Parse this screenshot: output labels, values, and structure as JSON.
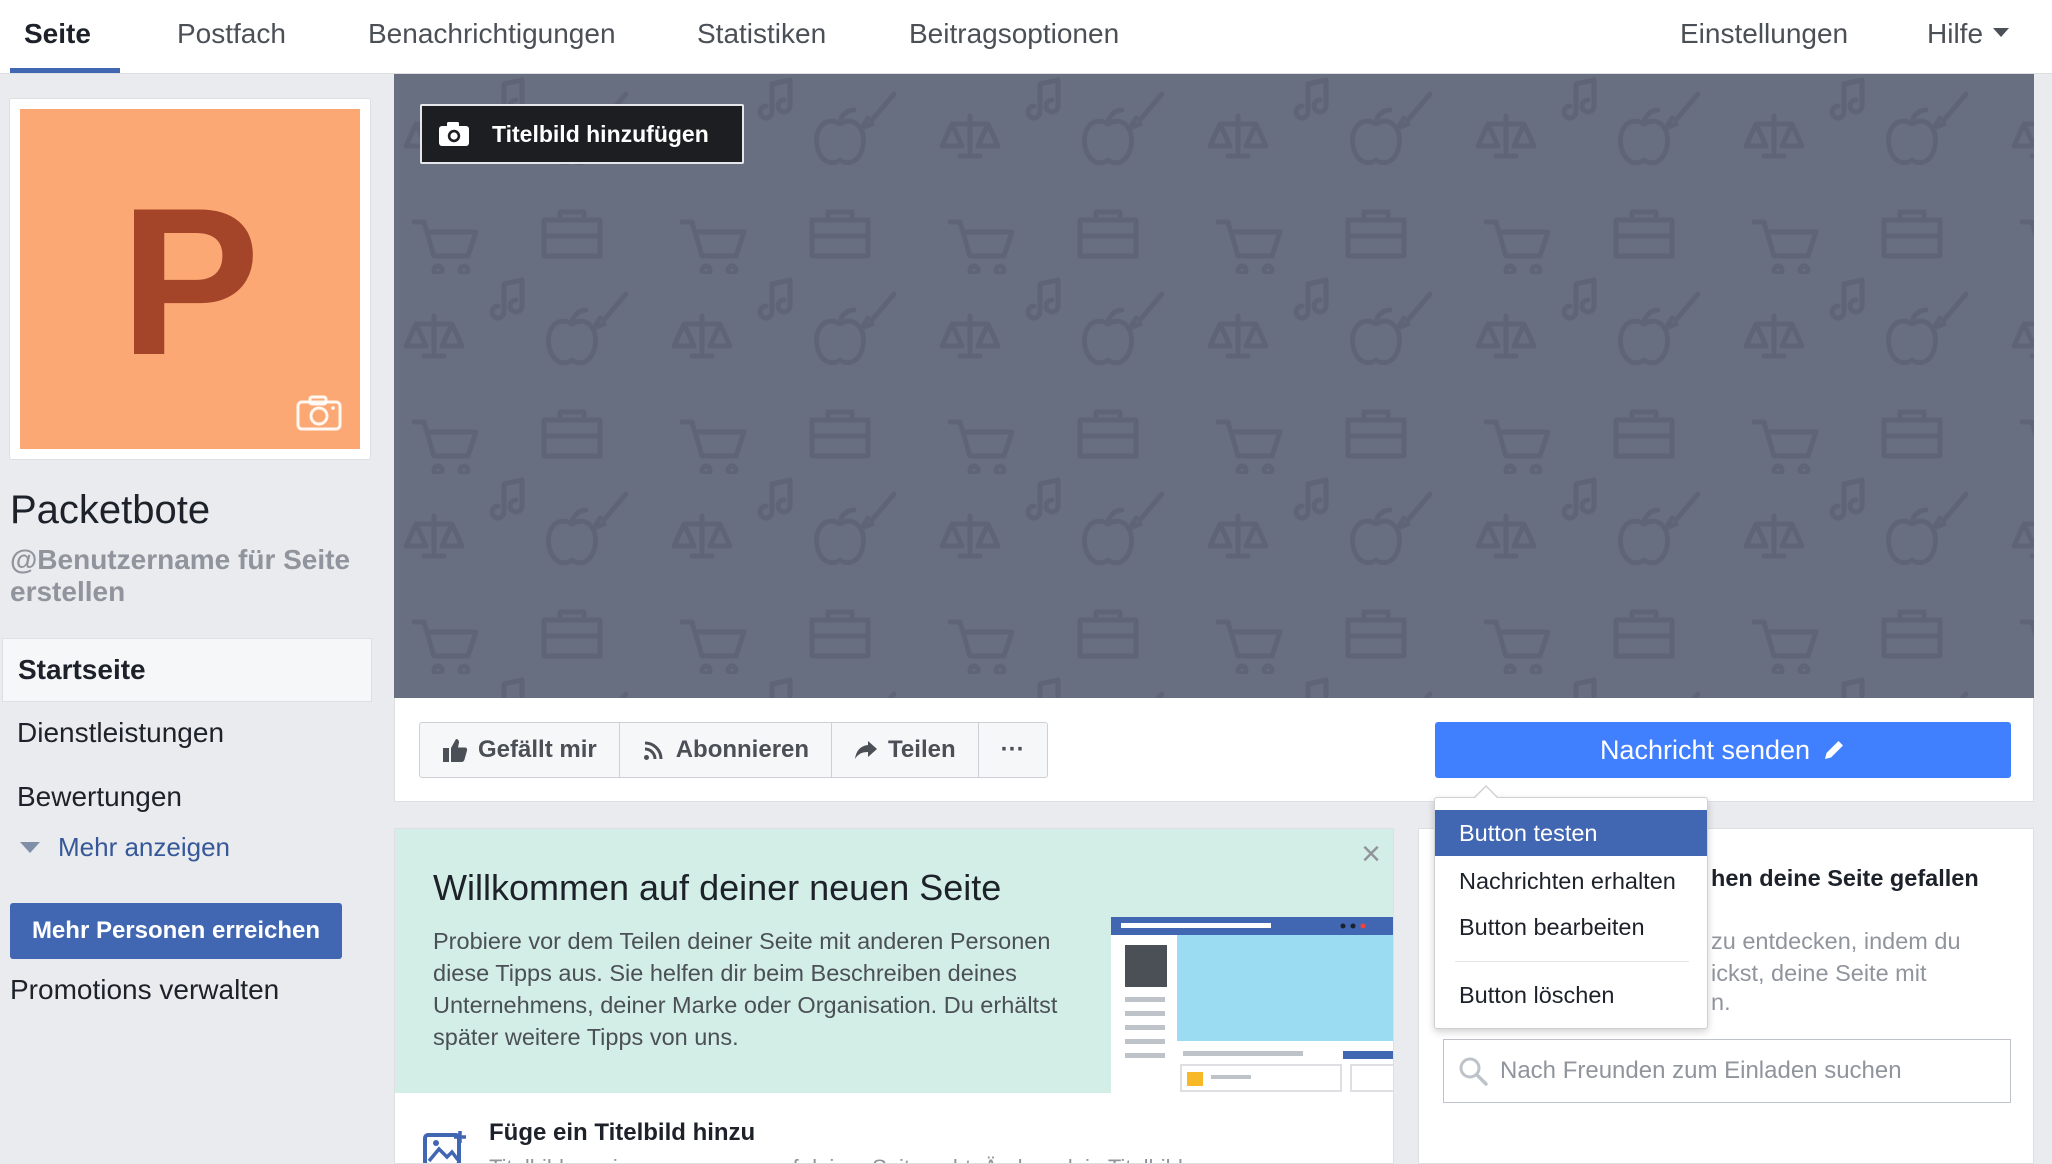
{
  "topnav": {
    "tabs": [
      {
        "label": "Seite"
      },
      {
        "label": "Postfach"
      },
      {
        "label": "Benachrichtigungen"
      },
      {
        "label": "Statistiken"
      },
      {
        "label": "Beitragsoptionen"
      }
    ],
    "right": [
      {
        "label": "Einstellungen"
      },
      {
        "label": "Hilfe"
      }
    ]
  },
  "profile": {
    "letter": "P",
    "name": "Packetbote",
    "username": "@Benutzername für Seite erstellen"
  },
  "leftnav": {
    "items": [
      {
        "label": "Startseite"
      },
      {
        "label": "Dienstleistungen"
      },
      {
        "label": "Bewertungen"
      }
    ],
    "more": "Mehr anzeigen",
    "reach_button": "Mehr Personen erreichen",
    "promotions": "Promotions verwalten"
  },
  "cover": {
    "add_button": "Titelbild hinzufügen"
  },
  "actions": {
    "like": "Gefällt mir",
    "follow": "Abonnieren",
    "share": "Teilen",
    "more": "···",
    "message": "Nachricht senden"
  },
  "dropdown": {
    "items": [
      {
        "label": "Button testen"
      },
      {
        "label": "Nachrichten erhalten"
      },
      {
        "label": "Button bearbeiten"
      },
      {
        "label": "Button löschen"
      }
    ]
  },
  "welcome": {
    "close": "×",
    "title": "Willkommen auf deiner neuen Seite",
    "text": "Probiere vor dem Teilen deiner Seite mit anderen Personen diese Tipps aus. Sie helfen dir beim Beschreiben deines Unternehmens, deiner Marke oder Organisation. Du erhältst später weitere Tipps von uns.",
    "tip_title": "Füge ein Titelbild hinzu",
    "tip_text": "Titelbilder zeigen, worum es auf deiner Seite geht. Ändere dein Titelbild, wenn es"
  },
  "invite": {
    "title_visible": "hen deine Seite gefallen",
    "text_visible_1": "zu entdecken, indem du",
    "text_visible_2": "ickst, deine Seite mit",
    "text_visible_3": "n.",
    "search_placeholder": "Nach Freunden zum Einladen suchen"
  },
  "colors": {
    "brand_blue": "#4267b2",
    "message_button": "#4080ff",
    "cover_bg": "#686f81",
    "profile_bg": "#fca874",
    "profile_letter": "#a4452a",
    "welcome_bg": "#d3eee6"
  }
}
